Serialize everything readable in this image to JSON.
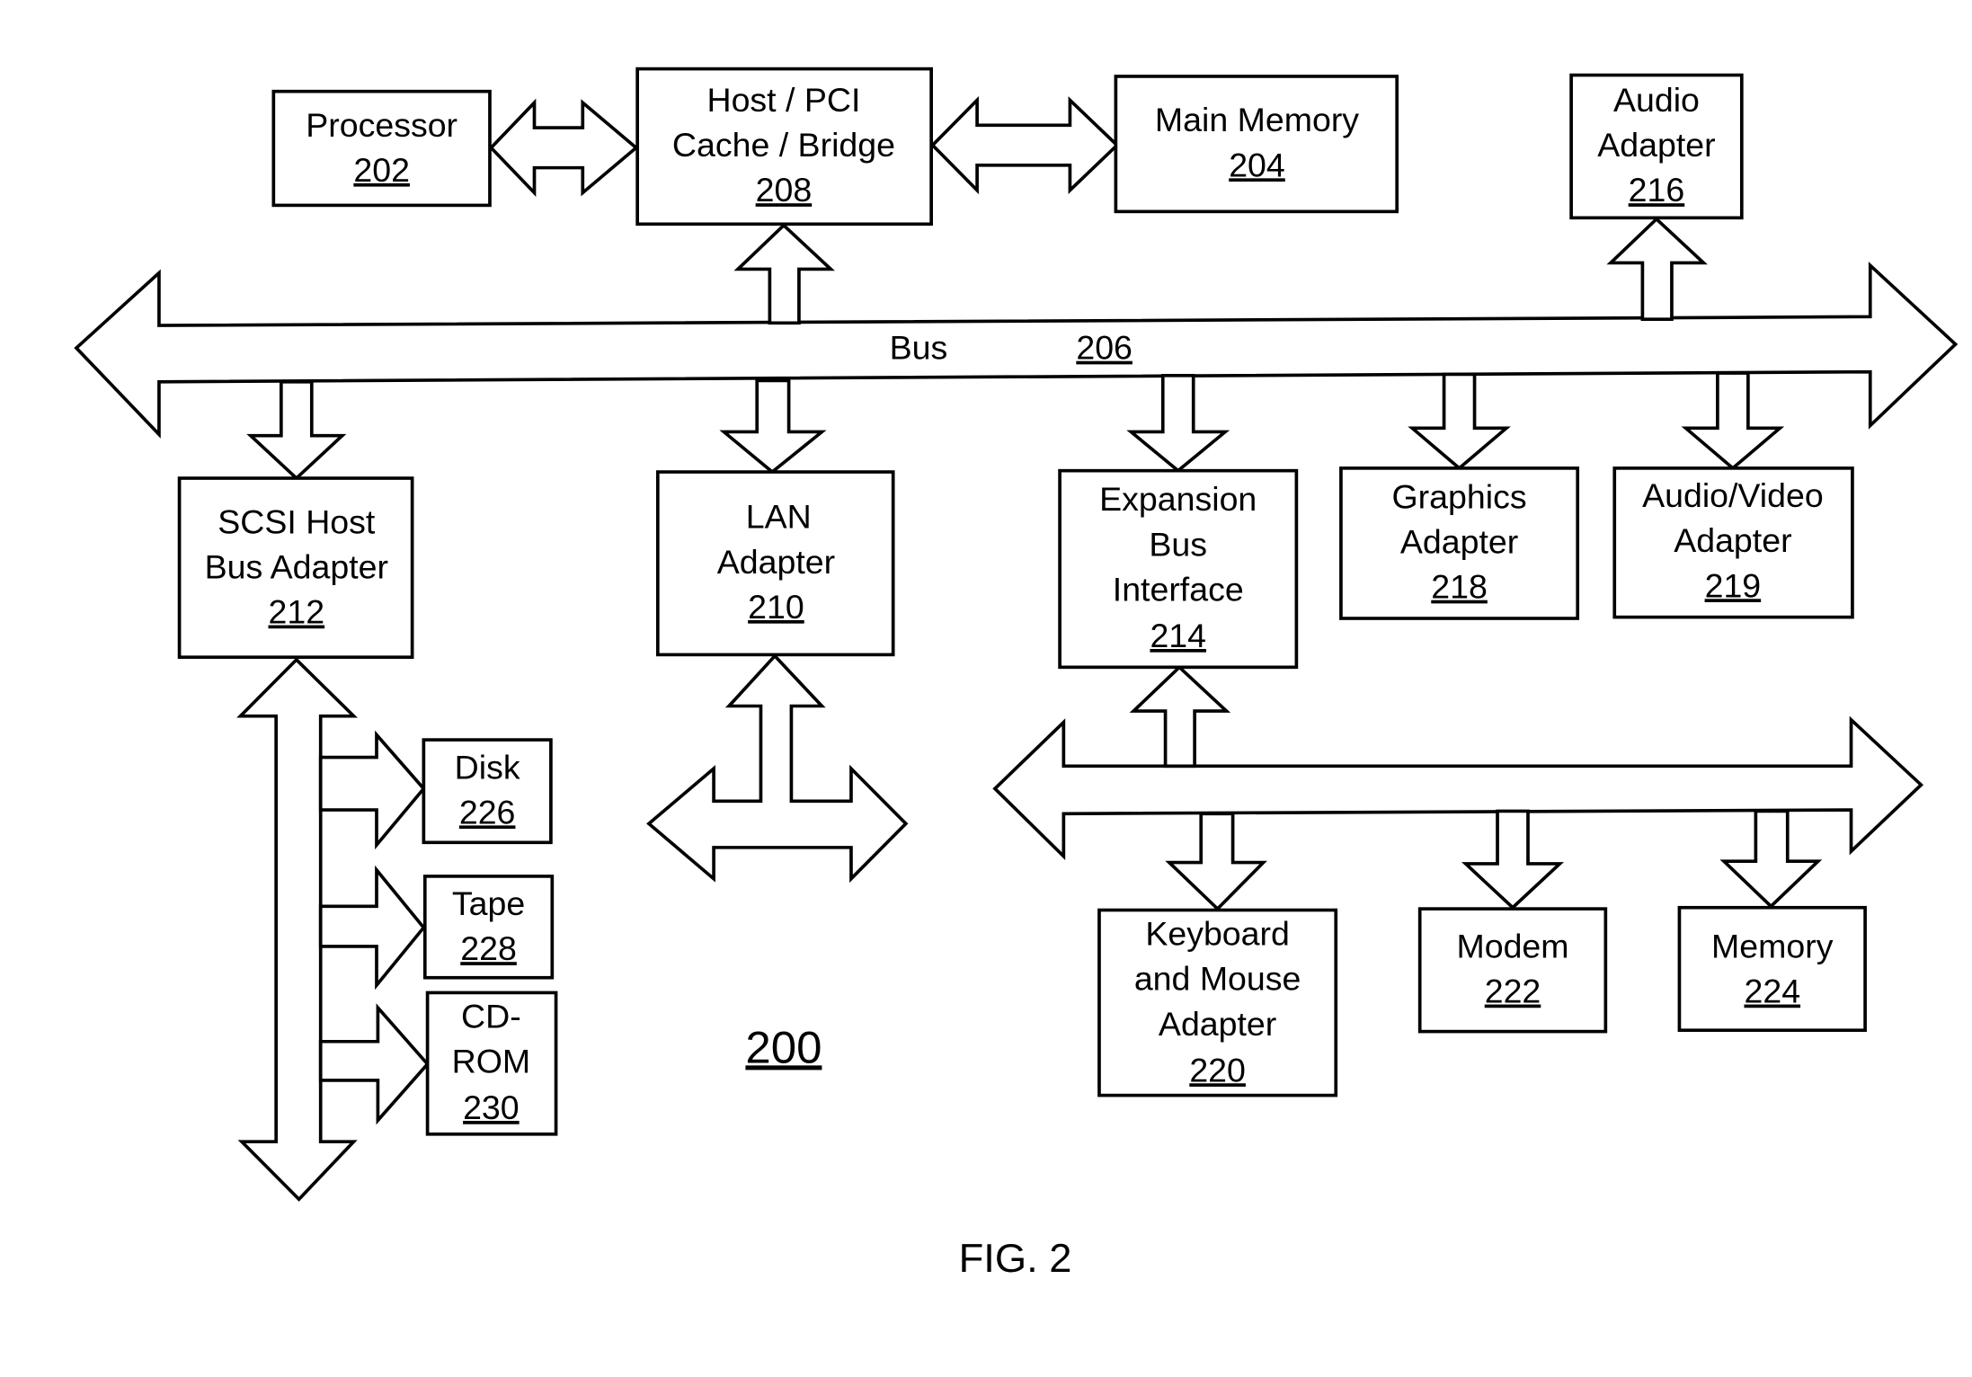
{
  "figure": {
    "caption": "FIG. 2",
    "reference_number": "200"
  },
  "bus": {
    "label": "Bus",
    "number": "206"
  },
  "components": {
    "processor": {
      "lines": [
        "Processor"
      ],
      "number": "202"
    },
    "host_bridge": {
      "lines": [
        "Host / PCI",
        "Cache / Bridge"
      ],
      "number": "208"
    },
    "main_memory": {
      "lines": [
        "Main Memory"
      ],
      "number": "204"
    },
    "audio_adapter": {
      "lines": [
        "Audio",
        "Adapter"
      ],
      "number": "216"
    },
    "scsi_adapter": {
      "lines": [
        "SCSI Host",
        "Bus Adapter"
      ],
      "number": "212"
    },
    "lan_adapter": {
      "lines": [
        "LAN",
        "Adapter"
      ],
      "number": "210"
    },
    "expansion_bus_interface": {
      "lines": [
        "Expansion",
        "Bus",
        "Interface"
      ],
      "number": "214"
    },
    "graphics_adapter": {
      "lines": [
        "Graphics",
        "Adapter"
      ],
      "number": "218"
    },
    "av_adapter": {
      "lines": [
        "Audio/Video",
        "Adapter"
      ],
      "number": "219"
    },
    "disk": {
      "lines": [
        "Disk"
      ],
      "number": "226"
    },
    "tape": {
      "lines": [
        "Tape"
      ],
      "number": "228"
    },
    "cdrom": {
      "lines": [
        "CD-",
        "ROM"
      ],
      "number": "230"
    },
    "kbd_mouse_adapter": {
      "lines": [
        "Keyboard",
        "and Mouse",
        "Adapter"
      ],
      "number": "220"
    },
    "modem": {
      "lines": [
        "Modem"
      ],
      "number": "222"
    },
    "memory": {
      "lines": [
        "Memory"
      ],
      "number": "224"
    }
  }
}
